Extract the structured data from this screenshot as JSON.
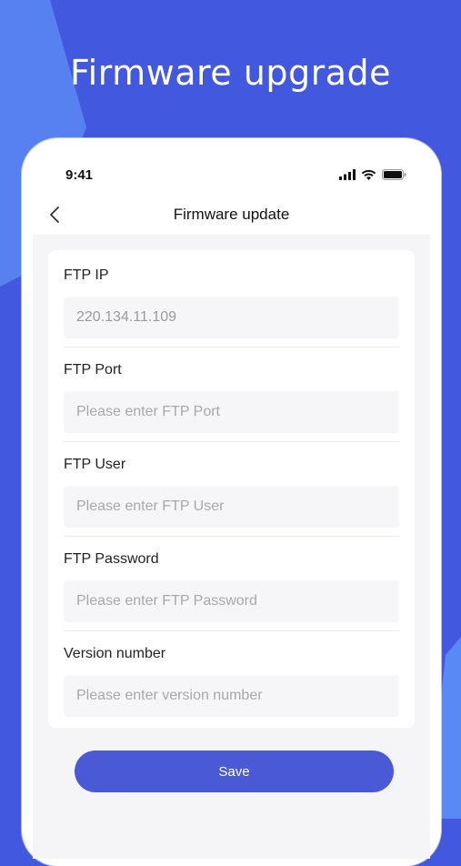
{
  "promo": {
    "title": "Firmware upgrade"
  },
  "status_bar": {
    "time": "9:41",
    "icons": [
      "cellular-signal-icon",
      "wifi-icon",
      "battery-icon"
    ]
  },
  "nav": {
    "back_icon": "chevron-left-icon",
    "title": "Firmware update"
  },
  "form": {
    "fields": [
      {
        "label": "FTP IP",
        "value": "220.134.11.109",
        "placeholder": ""
      },
      {
        "label": "FTP Port",
        "value": "",
        "placeholder": "Please enter FTP Port"
      },
      {
        "label": "FTP User",
        "value": "",
        "placeholder": "Please enter FTP User"
      },
      {
        "label": "FTP Password",
        "value": "",
        "placeholder": "Please enter FTP Password"
      },
      {
        "label": "Version number",
        "value": "",
        "placeholder": "Please enter version number"
      }
    ]
  },
  "actions": {
    "save_label": "Save"
  },
  "colors": {
    "background": "#4258de",
    "accent_light": "#5b8cf5",
    "button": "#4a5ad6",
    "card": "#ffffff",
    "input_bg": "#f6f6f8"
  }
}
